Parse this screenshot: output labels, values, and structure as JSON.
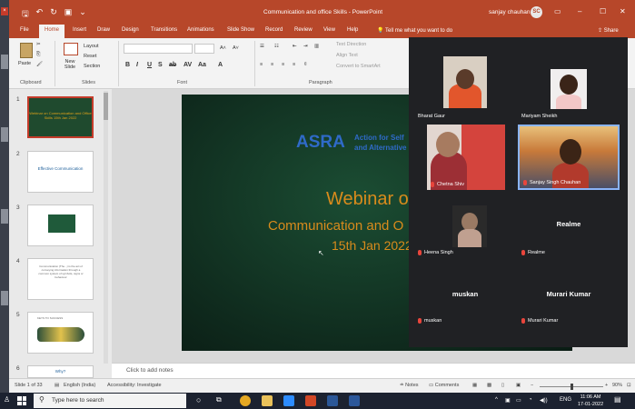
{
  "app": {
    "title": "Communication and office Skills  -  PowerPoint",
    "user": "sanjay chauhan",
    "user_initials": "SC"
  },
  "ribbon_tabs": [
    "File",
    "Home",
    "Insert",
    "Draw",
    "Design",
    "Transitions",
    "Animations",
    "Slide Show",
    "Record",
    "Review",
    "View",
    "Help"
  ],
  "tell_me": "Tell me what you want to do",
  "share": "Share",
  "ribbon": {
    "paste": "Paste",
    "new_slide": "New Slide",
    "layout": "Layout",
    "reset": "Reset",
    "section": "Section",
    "text_direction": "Text Direction",
    "align_text": "Align Text",
    "convert_smartart": "Convert to SmartArt",
    "groups": {
      "clipboard": "Clipboard",
      "slides": "Slides",
      "font": "Font",
      "paragraph": "Paragraph"
    }
  },
  "thumbnails": {
    "numbers": [
      "1",
      "2",
      "3",
      "4",
      "5",
      "6"
    ],
    "t1_text": "Webinar on Communication and Office Skills 15th Jan 2022",
    "t2_text": "Effective Communication",
    "t4_text": "Communication (The...) is the act of conveying information through a common system of symbols, signs or behaviour",
    "t5_text": "KEYS TO SUCCESS",
    "t6_text": "Why?"
  },
  "slide": {
    "logo": "ASRA",
    "logo_sub_1": "Action for Self",
    "logo_sub_2": "and Alternative",
    "line1": "Webinar o",
    "line2": "Communication and O",
    "line3": "15th Jan 2022"
  },
  "notes_placeholder": "Click to add notes",
  "statusbar": {
    "slide_of": "Slide 1 of 33",
    "language": "English (India)",
    "accessibility": "Accessibility: Investigate",
    "notes": "Notes",
    "comments": "Comments",
    "zoom": "90%"
  },
  "meeting": {
    "participants": [
      {
        "name": "Bharat Gaur",
        "video": true
      },
      {
        "name": "Mariyam Sheikh",
        "video": true
      },
      {
        "name": "Chetna Shiv",
        "video": true
      },
      {
        "name": "Sanjay Singh Chauhan",
        "video": true
      },
      {
        "name": "Heena Singh",
        "video": true
      },
      {
        "name": "Realme",
        "video": false
      },
      {
        "name": "muskan",
        "video": false
      },
      {
        "name": "Murari Kumar",
        "video": false
      }
    ]
  },
  "taskbar": {
    "search_placeholder": "Type here to search",
    "time": "11:06 AM",
    "date": "17-01-2022",
    "language": "ENG"
  },
  "colors": {
    "accent": "#b7472a",
    "slide_orange": "#d98b1c",
    "slide_blue": "#2f6ac8"
  }
}
